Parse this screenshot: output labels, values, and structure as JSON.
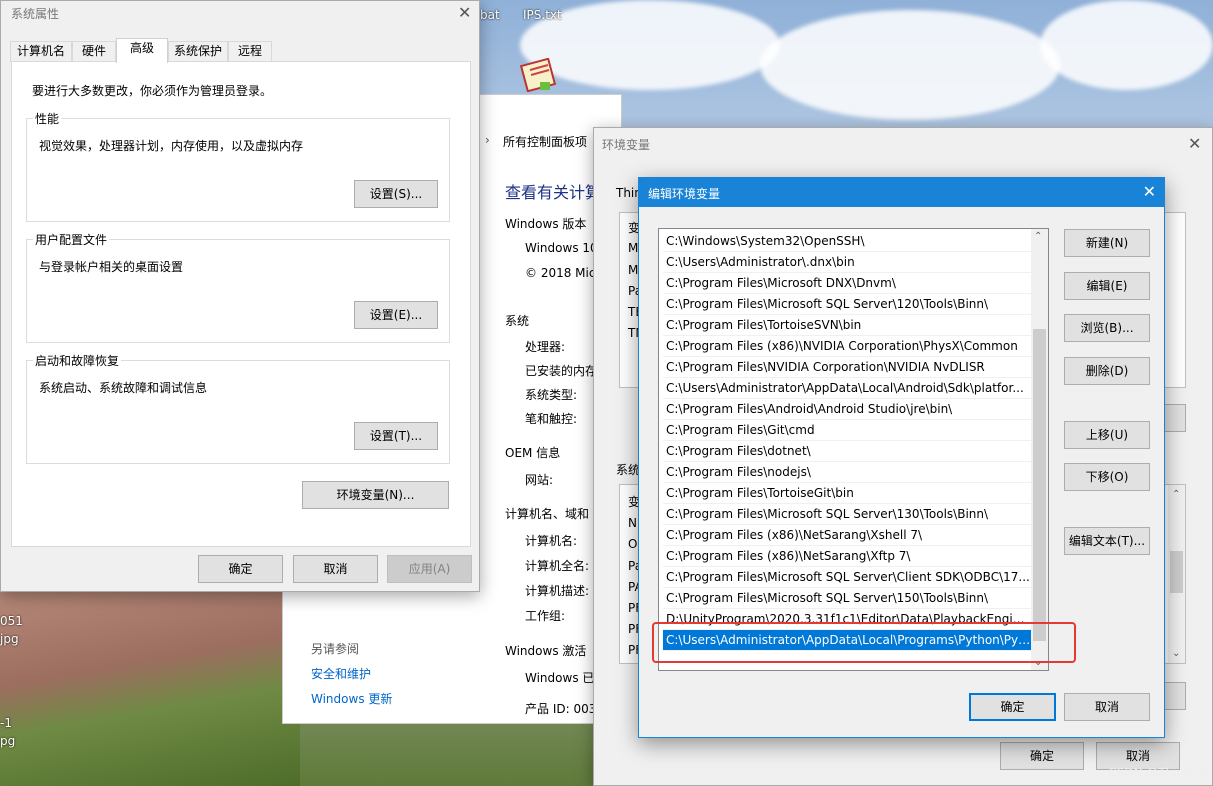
{
  "desktop": {
    "labels": [
      "bat",
      "IPS.txt",
      "051",
      "jpg",
      "-1",
      "pg"
    ]
  },
  "control_panel": {
    "breadcrumb_arrow": "›",
    "breadcrumb": "所有控制面板项",
    "heading": "查看有关计算",
    "windows_edition_label": "Windows 版本",
    "windows_name": "Windows 10",
    "copyright": "© 2018 Mic",
    "system_label": "系统",
    "processor": "处理器:",
    "installed_memory": "已安装的内存",
    "system_type": "系统类型:",
    "pen_touch": "笔和触控:",
    "oem_label": "OEM 信息",
    "website": "网站:",
    "computer_name_label": "计算机名、域和",
    "computer_name": "计算机名:",
    "full_name": "计算机全名:",
    "description": "计算机描述:",
    "workgroup": "工作组:",
    "activation_label": "Windows 激活",
    "windows_activated": "Windows 已",
    "product_id": "产品 ID: 003",
    "see_also": "另请参阅",
    "security": "安全和维护",
    "update": "Windows 更新"
  },
  "sysprops": {
    "title": "系统属性",
    "tabs": [
      "计算机名",
      "硬件",
      "高级",
      "系统保护",
      "远程"
    ],
    "admin_note": "要进行大多数更改，你必须作为管理员登录。",
    "perf_title": "性能",
    "perf_desc": "视觉效果，处理器计划，内存使用，以及虚拟内存",
    "perf_button": "设置(S)...",
    "profile_title": "用户配置文件",
    "profile_desc": "与登录帐户相关的桌面设置",
    "profile_button": "设置(E)...",
    "startup_title": "启动和故障恢复",
    "startup_desc": "系统启动、系统故障和调试信息",
    "startup_button": "设置(T)...",
    "env_button": "环境变量(N)...",
    "ok": "确定",
    "cancel": "取消",
    "apply": "应用(A)"
  },
  "envvars": {
    "title": "环境变量",
    "user_section": "Thin",
    "user_rows": [
      "变",
      "M",
      "M",
      "Pa",
      "TE",
      "TM"
    ],
    "system_section": "系统",
    "system_rows": [
      "变",
      "N",
      "O",
      "Pa",
      "PA",
      "PF",
      "PF",
      "PF"
    ],
    "ok": "确定",
    "cancel": "取消"
  },
  "editenv": {
    "title": "编辑环境变量",
    "paths": [
      "C:\\Windows\\System32\\OpenSSH\\",
      "C:\\Users\\Administrator\\.dnx\\bin",
      "C:\\Program Files\\Microsoft DNX\\Dnvm\\",
      "C:\\Program Files\\Microsoft SQL Server\\120\\Tools\\Binn\\",
      "C:\\Program Files\\TortoiseSVN\\bin",
      "C:\\Program Files (x86)\\NVIDIA Corporation\\PhysX\\Common",
      "C:\\Program Files\\NVIDIA Corporation\\NVIDIA NvDLISR",
      "C:\\Users\\Administrator\\AppData\\Local\\Android\\Sdk\\platfor...",
      "C:\\Program Files\\Android\\Android Studio\\jre\\bin\\",
      "C:\\Program Files\\Git\\cmd",
      "C:\\Program Files\\dotnet\\",
      "C:\\Program Files\\nodejs\\",
      "C:\\Program Files\\TortoiseGit\\bin",
      "C:\\Program Files\\Microsoft SQL Server\\130\\Tools\\Binn\\",
      "C:\\Program Files (x86)\\NetSarang\\Xshell 7\\",
      "C:\\Program Files (x86)\\NetSarang\\Xftp 7\\",
      "C:\\Program Files\\Microsoft SQL Server\\Client SDK\\ODBC\\17...",
      "C:\\Program Files\\Microsoft SQL Server\\150\\Tools\\Binn\\",
      "D:\\UnityProgram\\2020.3.31f1c1\\Editor\\Data\\PlaybackEngines...",
      "C:\\Users\\Administrator\\AppData\\Local\\Programs\\Python\\Pyt..."
    ],
    "selected_index": 19,
    "new": "新建(N)",
    "edit": "编辑(E)",
    "browse": "浏览(B)...",
    "delete": "删除(D)",
    "move_up": "上移(U)",
    "move_down": "下移(O)",
    "edit_text": "编辑文本(T)...",
    "ok": "确定",
    "cancel": "取消"
  },
  "watermark": "CSDN @Thinbug"
}
